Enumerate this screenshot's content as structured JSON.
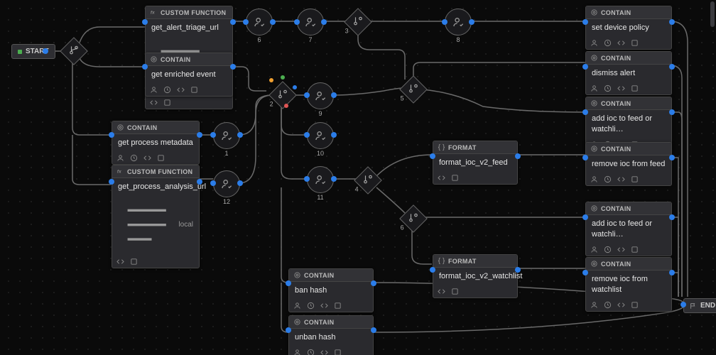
{
  "start_label": "START",
  "end_label": "END",
  "hdr_custom": "CUSTOM FUNCTION",
  "hdr_contain": "CONTAIN",
  "hdr_format": "FORMAT",
  "sub_local": "local",
  "nodes": {
    "cf1": {
      "title": "get_alert_triage_url"
    },
    "ct1": {
      "title": "get enriched event"
    },
    "ct2": {
      "title": "get process metadata"
    },
    "cf2": {
      "title": "get_process_analysis_url"
    },
    "fmt1": {
      "title": "format_ioc_v2_feed"
    },
    "fmt2": {
      "title": "format_ioc_v2_watchlist"
    },
    "r1": {
      "title": "set device policy"
    },
    "r2": {
      "title": "dismiss alert"
    },
    "r3": {
      "title": "add ioc to feed or watchli…"
    },
    "r4": {
      "title": "remove ioc from feed"
    },
    "r5": {
      "title": "add ioc to feed or watchli…"
    },
    "r6": {
      "title": "remove ioc from watchlist"
    },
    "ct_ban": {
      "title": "ban hash"
    },
    "ct_unban": {
      "title": "unban hash"
    }
  },
  "round_labels": {
    "r1": "1",
    "r6": "6",
    "r7": "7",
    "r8": "8",
    "r9": "9",
    "r10": "10",
    "r11": "11",
    "r12": "12"
  },
  "dec_labels": {
    "d2": "2",
    "d3": "3",
    "d4": "4",
    "d5": "5",
    "d6": "6"
  }
}
